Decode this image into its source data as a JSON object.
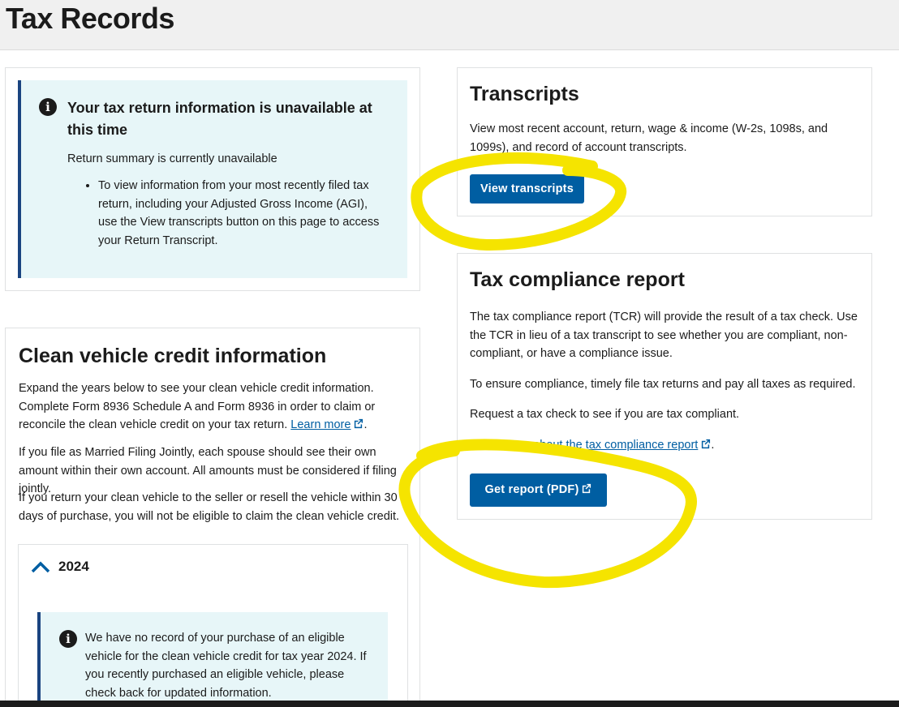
{
  "header": {
    "title": "Tax Records"
  },
  "return_alert": {
    "icon": "info-icon",
    "heading": "Your tax return information is unavailable at this time",
    "summary": "Return summary is currently unavailable",
    "bullet": "To view information from your most recently filed tax return, including your Adjusted Gross Income (AGI), use the View transcripts button on this page to access your Return Transcript."
  },
  "transcripts": {
    "heading": "Transcripts",
    "description": "View most recent account, return, wage & income (W-2s, 1098s, and 1099s), and record of account transcripts.",
    "button_label": "View transcripts"
  },
  "compliance": {
    "heading": "Tax compliance report",
    "paragraph1": "The tax compliance report (TCR) will provide the result of a tax check. Use the TCR in lieu of a tax transcript to see whether you are compliant, non-compliant, or have a compliance issue.",
    "paragraph2": "To ensure compliance, timely file tax returns and pay all taxes as required.",
    "paragraph3": "Request a tax check to see if you are tax compliant.",
    "learn_more_link": "Learn more about the tax compliance report",
    "button_label": "Get report (PDF)"
  },
  "clean_vehicle": {
    "heading": "Clean vehicle credit information",
    "paragraph1": "Expand the years below to see your clean vehicle credit information. Complete Form 8936 Schedule A and Form 8936 in order to claim or reconcile the clean vehicle credit on your tax return.",
    "learn_more_link": "Learn more",
    "paragraph2": "If you file as Married Filing Jointly, each spouse should see their own amount within their own account. All amounts must be considered if filing jointly.",
    "paragraph3": "If you return your clean vehicle to the seller or resell the vehicle within 30 days of purchase, you will not be eligible to claim the clean vehicle credit.",
    "accordion": {
      "year": "2024",
      "icon": "chevron-up-icon",
      "alert_text": "We have no record of your purchase of an eligible vehicle for the clean vehicle credit for tax year 2024. If you recently purchased an eligible vehicle, please check back for updated information."
    }
  },
  "colors": {
    "primary_button": "#005ea2",
    "alert_background": "#e7f6f8",
    "alert_border": "#1a4480",
    "header_background": "#f0f0f0",
    "highlight_marker": "#f5e400"
  }
}
